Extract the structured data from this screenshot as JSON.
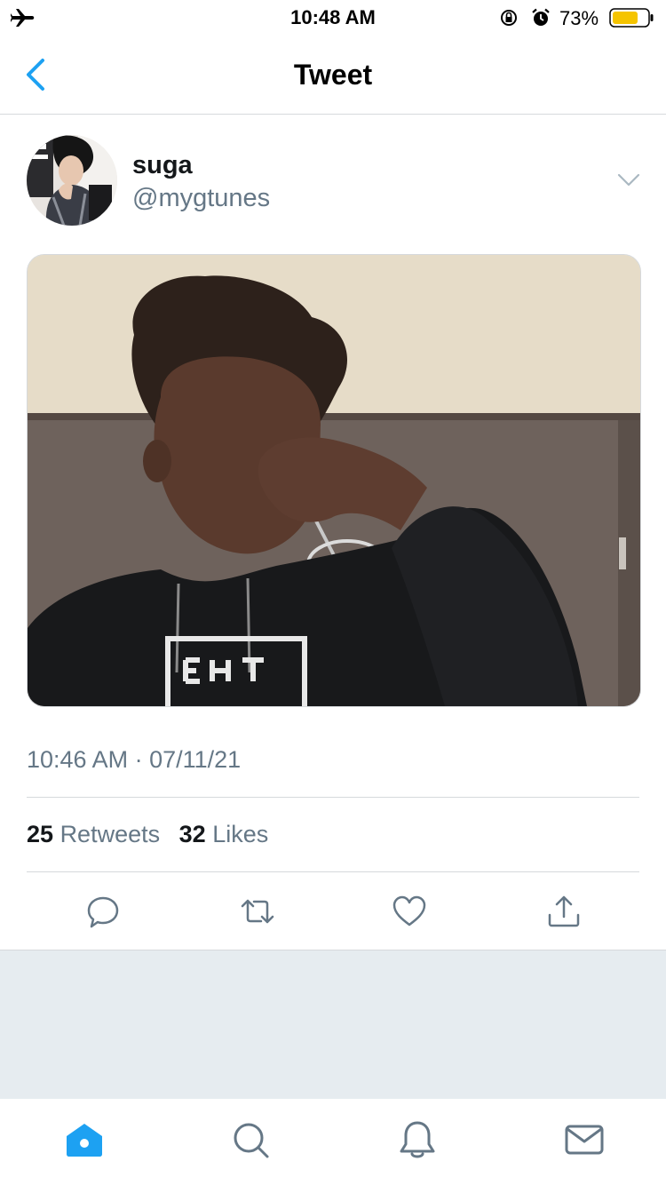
{
  "status_bar": {
    "time": "10:48 AM",
    "battery_percent_text": "73%",
    "battery_level": 0.73,
    "battery_color": "#f5c400",
    "icons": [
      "airplane-icon",
      "rotation-lock-icon",
      "alarm-icon",
      "battery-icon"
    ]
  },
  "nav": {
    "title": "Tweet",
    "back_icon": "chevron-left-icon",
    "accent": "#1da1f2"
  },
  "tweet": {
    "author_name": "suga",
    "author_handle": "@mygtunes",
    "timestamp": "10:46 AM · 07/11/21",
    "retweets_count": "25",
    "retweets_label": "Retweets",
    "likes_count": "32",
    "likes_label": "Likes"
  },
  "actions": [
    "reply-icon",
    "retweet-icon",
    "like-icon",
    "share-icon"
  ],
  "tab_bar": [
    "home-icon",
    "search-icon",
    "notifications-icon",
    "messages-icon"
  ],
  "colors": {
    "text_primary": "#14171a",
    "text_secondary": "#657786",
    "divider": "#d6d9dc",
    "background_gray": "#e6ecf0",
    "brand_blue": "#1da1f2"
  }
}
